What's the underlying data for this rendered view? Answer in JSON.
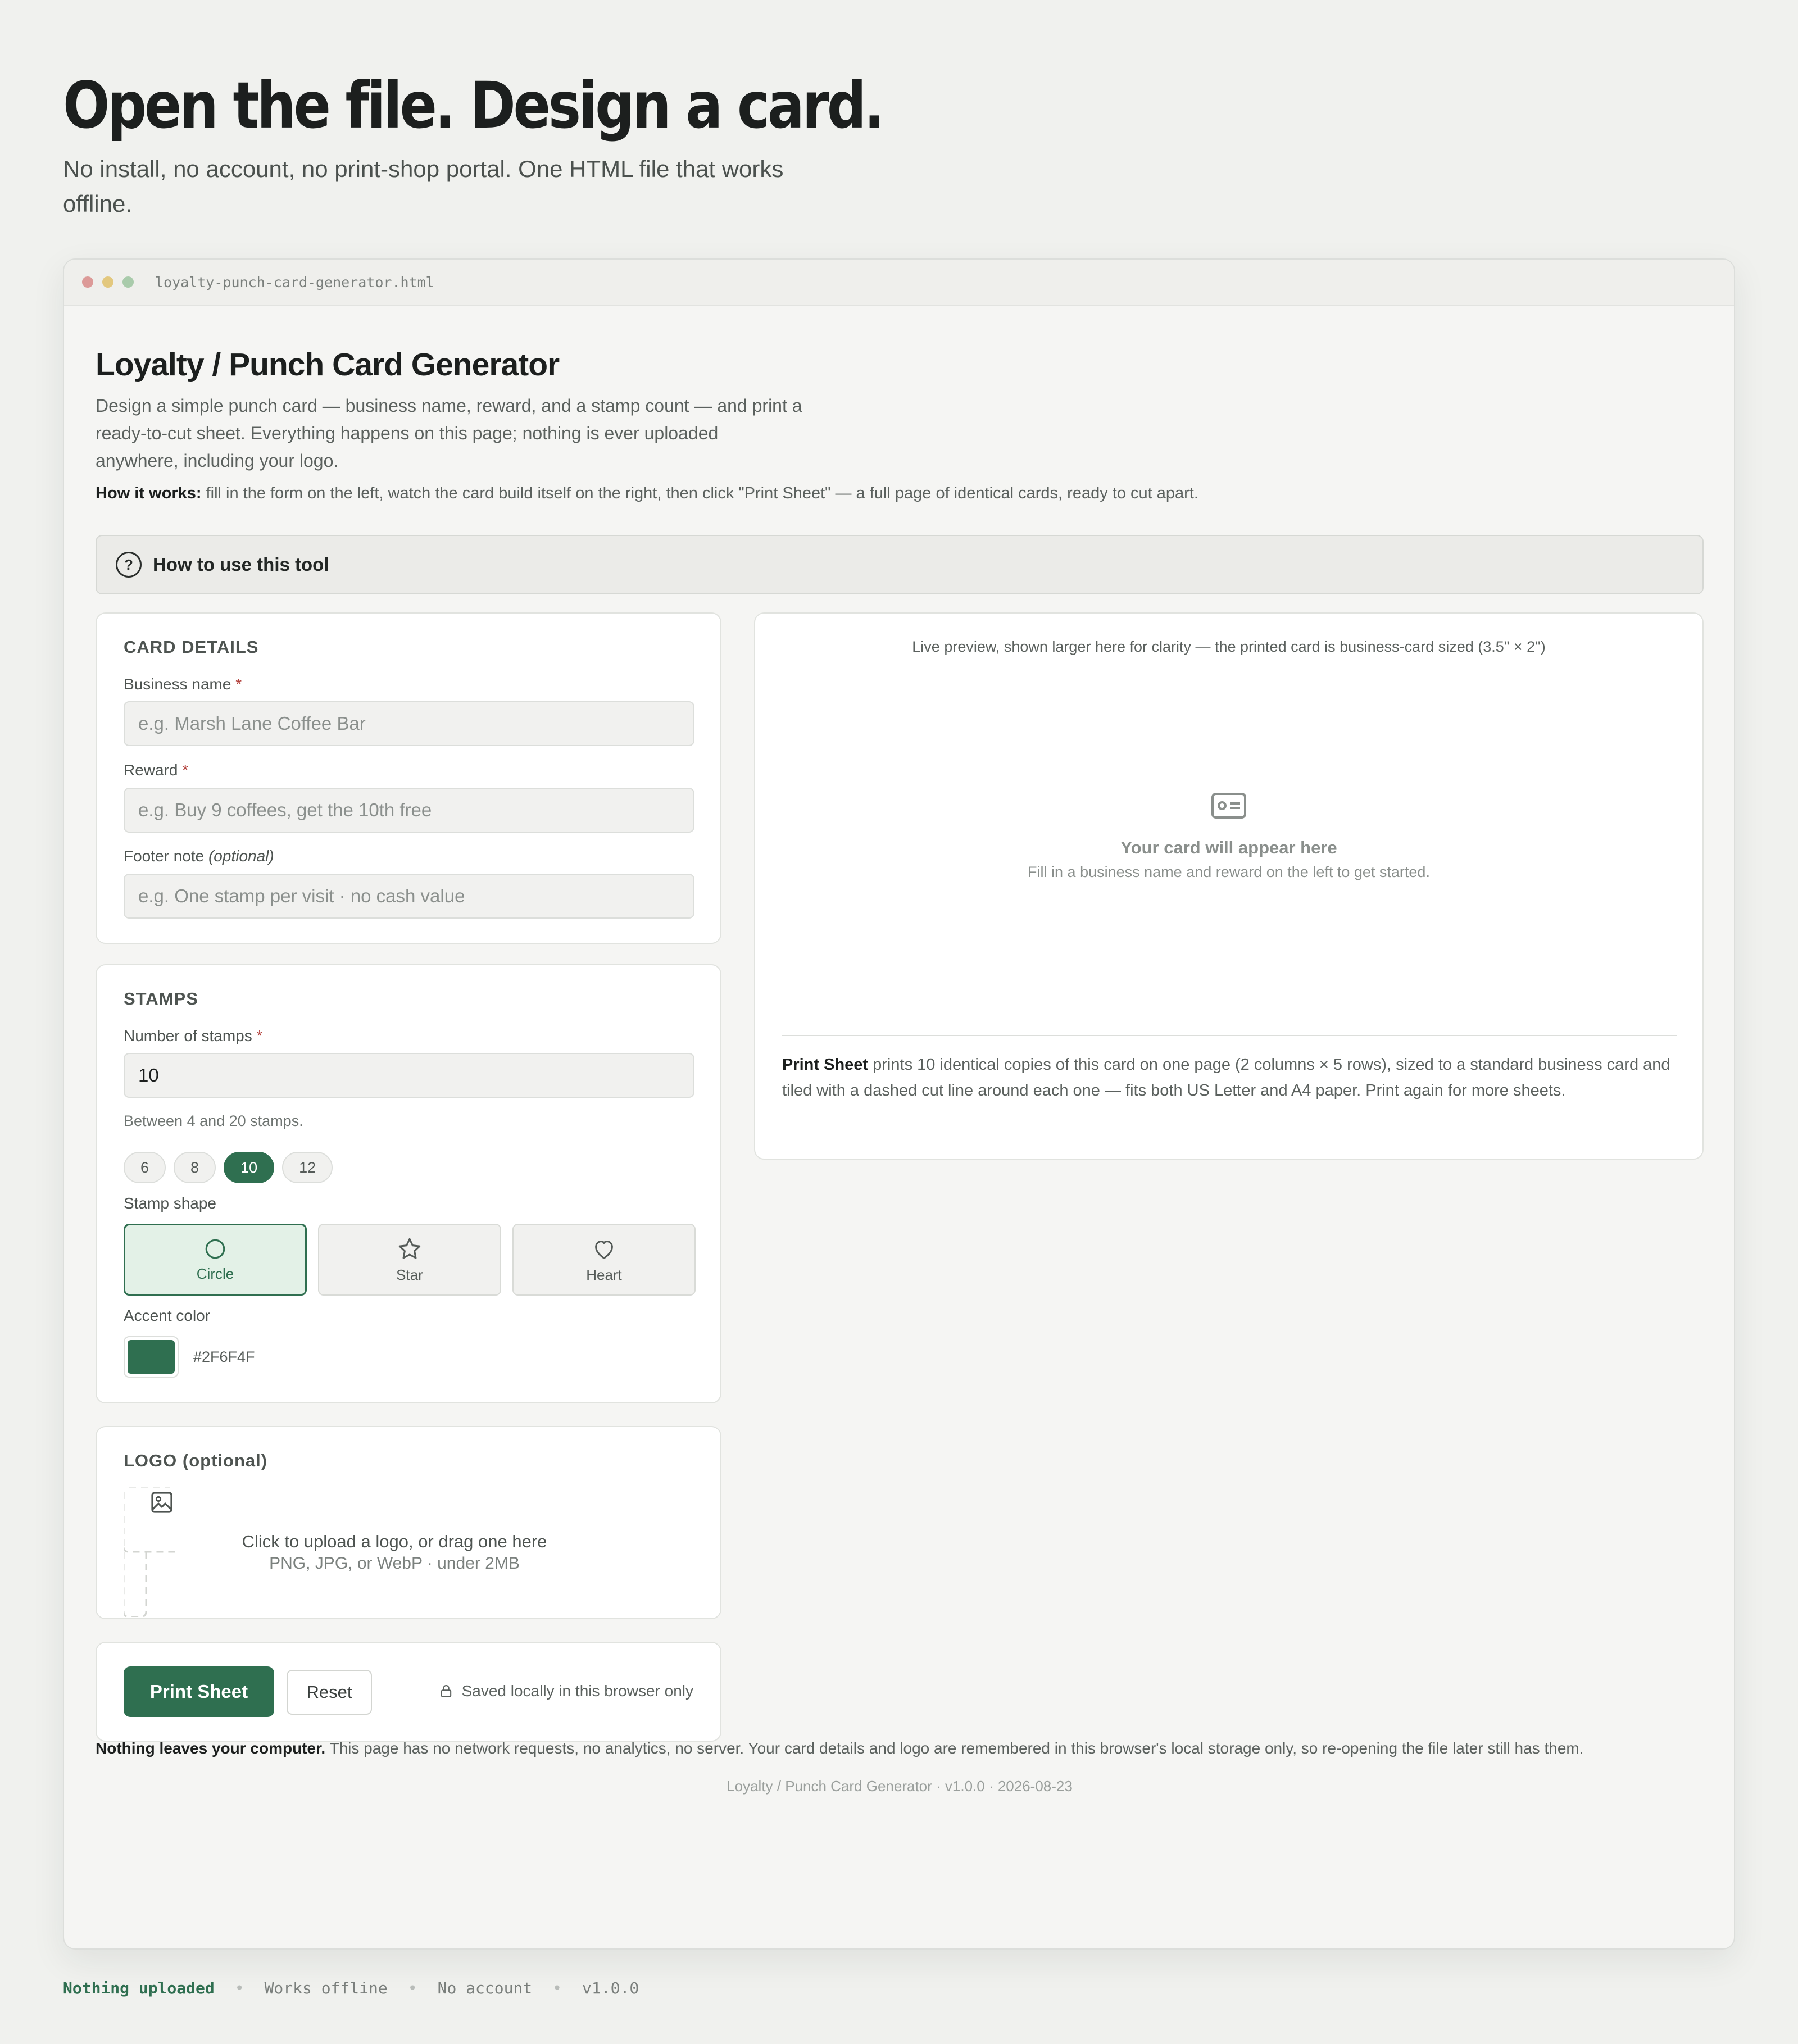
{
  "hero": {
    "title": "Open the file. Design a card.",
    "subtitle": "No install, no account, no print-shop portal. One HTML file that works offline."
  },
  "window": {
    "filename": "loyalty-punch-card-generator.html"
  },
  "app": {
    "title": "Loyalty / Punch Card Generator",
    "description": "Design a simple punch card — business name, reward, and a stamp count — and print a ready-to-cut sheet. Everything happens on this page; nothing is ever uploaded anywhere, including your logo.",
    "how_works_label": "How it works:",
    "how_works_text": " fill in the form on the left, watch the card build itself on the right, then click \"Print Sheet\" — a full page of identical cards, ready to cut apart."
  },
  "howto": {
    "label": "How to use this tool",
    "icon": "question-circle-icon"
  },
  "card_details": {
    "title": "CARD DETAILS",
    "business_label": "Business name",
    "business_placeholder": "e.g. Marsh Lane Coffee Bar",
    "reward_label": "Reward",
    "reward_placeholder": "e.g. Buy 9 coffees, get the 10th free",
    "footer_label": "Footer note",
    "footer_optional": "(optional)",
    "footer_placeholder": "e.g. One stamp per visit · no cash value",
    "required_mark": "*"
  },
  "stamps": {
    "title": "STAMPS",
    "count_label": "Number of stamps",
    "count_value": "10",
    "count_hint": "Between 4 and 20 stamps.",
    "presets": [
      "6",
      "8",
      "10",
      "12"
    ],
    "active_preset": "10",
    "shape_label": "Stamp shape",
    "shapes": [
      "Circle",
      "Star",
      "Heart"
    ],
    "active_shape": "Circle",
    "accent_label": "Accent color",
    "accent_hex": "#2F6F4F",
    "accent_color": "#2f6f50"
  },
  "logo": {
    "title": "LOGO (optional)",
    "upload_line1": "Click to upload a logo, or drag one here",
    "upload_line2": "PNG, JPG, or WebP · under 2MB",
    "icon": "image-icon"
  },
  "actions": {
    "print_label": "Print Sheet",
    "reset_label": "Reset",
    "saved_label": "Saved locally in this browser only",
    "saved_icon": "lock-icon"
  },
  "preview": {
    "caption": "Live preview, shown larger here for clarity — the printed card is business-card sized (3.5\" × 2\")",
    "empty_title": "Your card will appear here",
    "empty_sub": "Fill in a business name and reward on the left to get started.",
    "empty_icon": "id-card-icon",
    "print_note_label": "Print Sheet",
    "print_note_text": " prints 10 identical copies of this card on one page (2 columns × 5 rows), sized to a standard business card and tiled with a dashed cut line around each one — fits both US Letter and A4 paper. Print again for more sheets."
  },
  "footer": {
    "privacy_label": "Nothing leaves your computer.",
    "privacy_text": " This page has no network requests, no analytics, no server. Your card details and logo are remembered in this browser's local storage only, so re-opening the file later still has them.",
    "version": "Loyalty / Punch Card Generator · v1.0.0 · 2026-08-23"
  },
  "status_bar": {
    "items": [
      "Nothing uploaded",
      "Works offline",
      "No account",
      "v1.0.0"
    ],
    "separator": "•"
  }
}
